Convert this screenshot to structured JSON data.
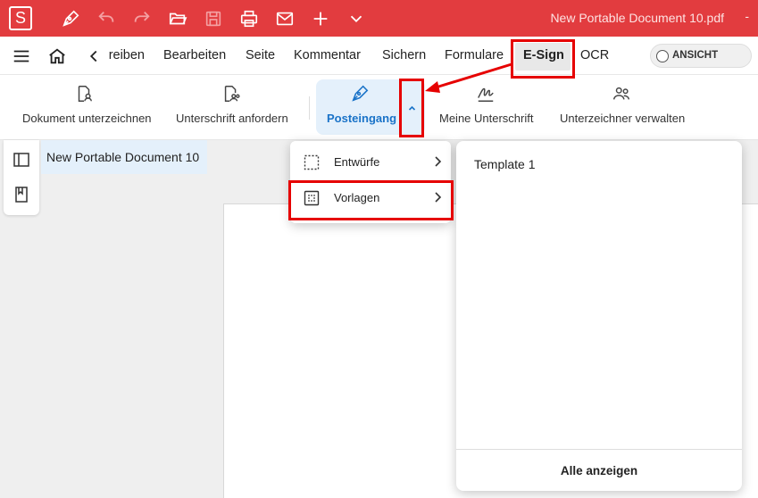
{
  "titlebar": {
    "logo": "S",
    "doc_title": "New Portable Document 10.pdf",
    "dash": "-",
    "icons": [
      "pen-icon",
      "undo-icon",
      "redo-icon",
      "open-folder-icon",
      "save-icon",
      "print-icon",
      "mail-icon",
      "plus-icon",
      "chevron-down-icon"
    ]
  },
  "menubar": {
    "items": [
      "reiben",
      "Bearbeiten",
      "Seite",
      "Kommentar",
      "Sichern",
      "Formulare",
      "E-Sign",
      "OCR"
    ],
    "active": "E-Sign",
    "ansicht": "ANSICHT"
  },
  "ribbon": {
    "buttons": [
      {
        "label": "Dokument unterzeichnen",
        "icon": "document-user-icon"
      },
      {
        "label": "Unterschrift anfordern",
        "icon": "document-users-icon"
      },
      {
        "label": "Posteingang",
        "icon": "fountain-pen-icon"
      },
      {
        "label": "Meine Unterschrift",
        "icon": "signature-icon"
      },
      {
        "label": "Unterzeichner verwalten",
        "icon": "people-icon"
      }
    ]
  },
  "document": {
    "tab_title": "New Portable Document 10"
  },
  "dropdown": {
    "items": [
      {
        "label": "Entwürfe",
        "icon": "dashed-square-icon"
      },
      {
        "label": "Vorlagen",
        "icon": "dotted-grid-icon"
      }
    ]
  },
  "templates": {
    "items": [
      "Template 1"
    ],
    "show_all": "Alle anzeigen"
  },
  "colors": {
    "titlebar": "#e23c3f",
    "accent": "#1a73c8",
    "highlight": "#e60000",
    "ribbon_selected": "#e4f0fb"
  }
}
